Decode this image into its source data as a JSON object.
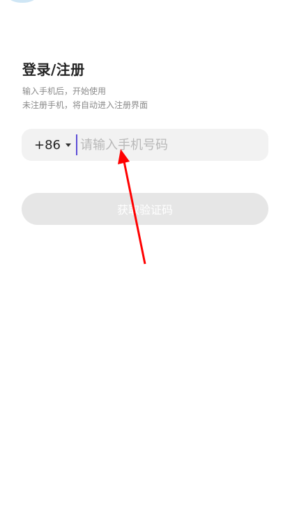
{
  "login": {
    "title": "登录/注册",
    "subtitle_line1": "输入手机后，开始使用",
    "subtitle_line2": "未注册手机，将自动进入注册界面"
  },
  "phone": {
    "country_code": "+86",
    "placeholder": "请输入手机号码",
    "value": ""
  },
  "actions": {
    "get_code_label": "获取验证码"
  },
  "colors": {
    "cursor": "#5b4bd6",
    "input_bg": "#f2f2f2",
    "button_disabled_bg": "#e6e6e6",
    "annotation_arrow": "#ff0000"
  }
}
